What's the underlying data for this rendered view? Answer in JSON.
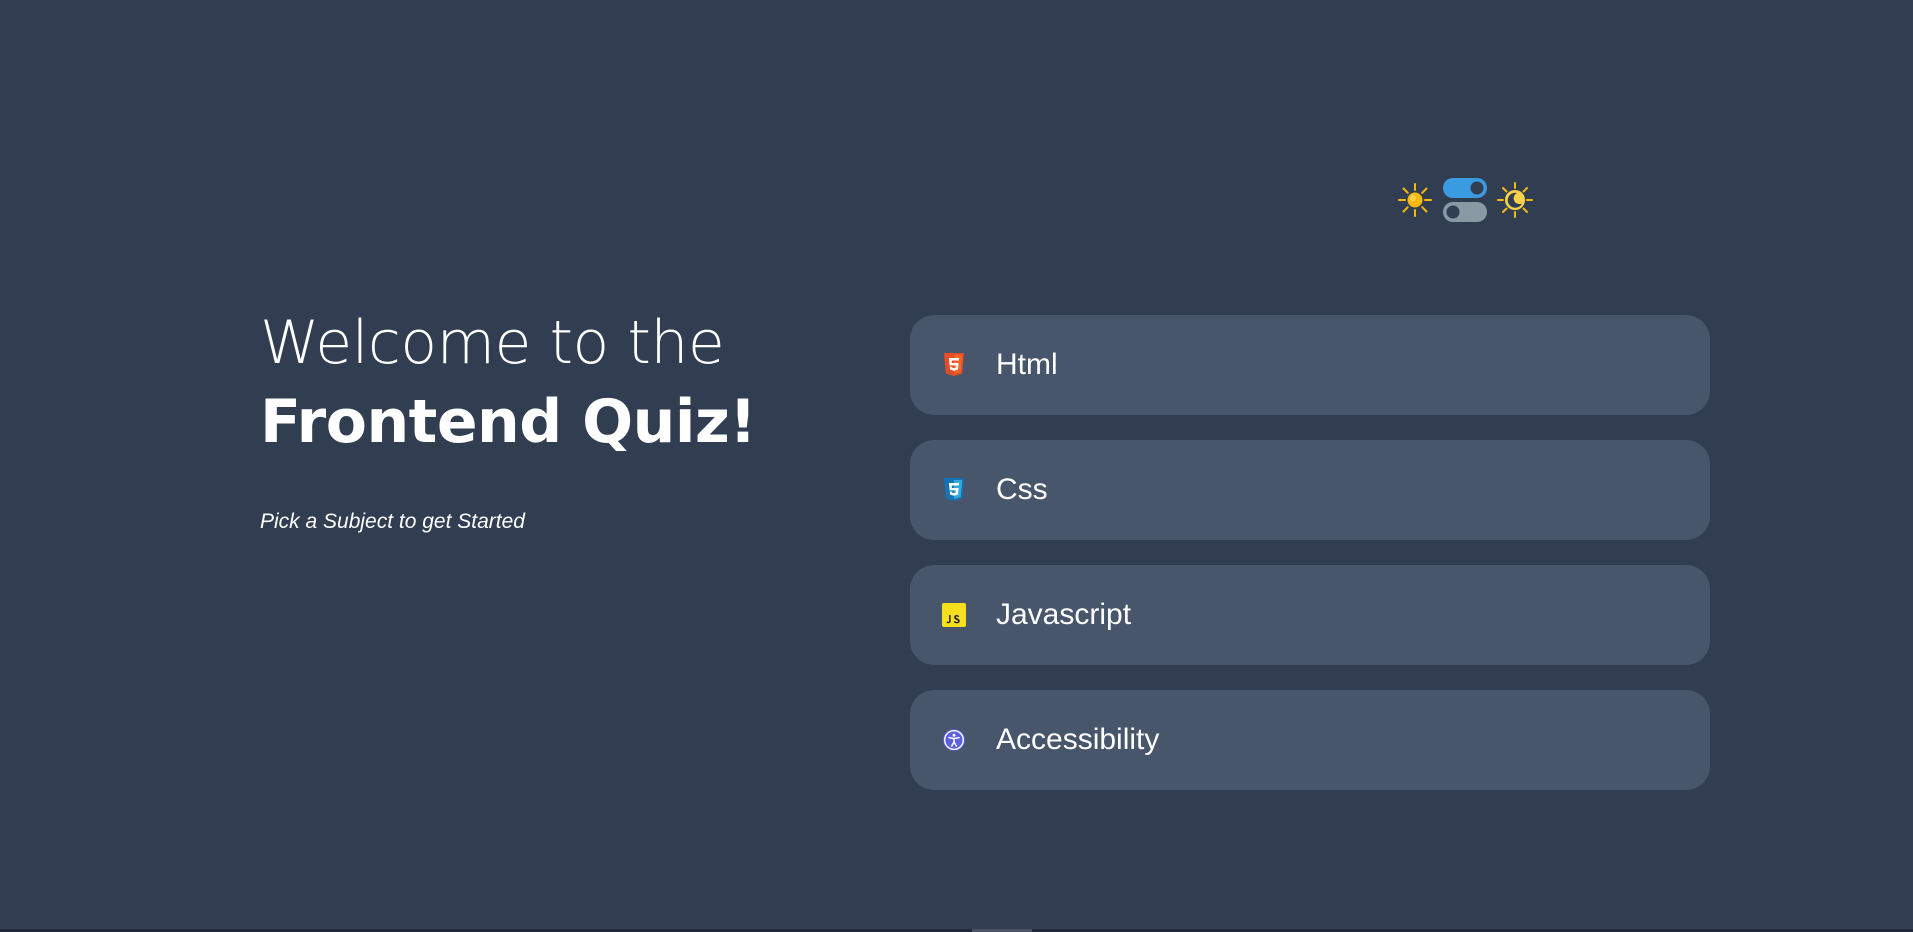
{
  "theme_toggle": {
    "light_icon": "sun-icon",
    "dark_icon": "sun-moon-icon",
    "switch_icon": "toggle-switch-icon"
  },
  "intro": {
    "welcome": "Welcome to the",
    "title": "Frontend Quiz!",
    "subtitle": "Pick a Subject to get Started"
  },
  "subjects": [
    {
      "label": "Html",
      "icon": "html5-icon",
      "color": "#e44d26"
    },
    {
      "label": "Css",
      "icon": "css3-icon",
      "color": "#1572b6"
    },
    {
      "label": "Javascript",
      "icon": "javascript-icon",
      "color": "#f7df1e"
    },
    {
      "label": "Accessibility",
      "icon": "accessibility-icon",
      "color": "#5b5fe0"
    }
  ],
  "colors": {
    "background": "#313e51",
    "card": "#47566b",
    "text": "#ffffff",
    "toggle_on": "#3b9be0",
    "toggle_off": "#8a9aa5",
    "sun": "#f8b90f"
  }
}
